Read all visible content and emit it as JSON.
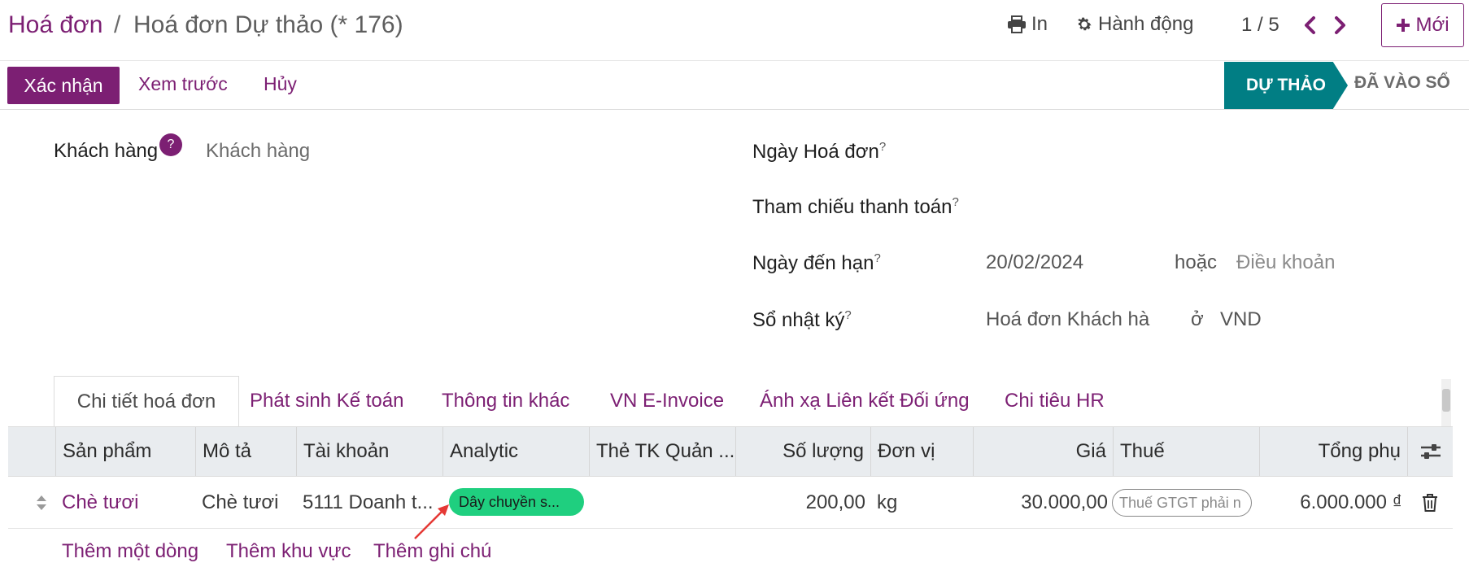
{
  "breadcrumb": {
    "root": "Hoá đơn",
    "separator": "/",
    "current": "Hoá đơn Dự thảo (* 176)"
  },
  "toolbar": {
    "print_label": "In",
    "action_label": "Hành động",
    "pager": "1 / 5",
    "new_label": "Mới"
  },
  "actions": {
    "confirm": "Xác nhận",
    "preview": "Xem trước",
    "cancel": "Hủy"
  },
  "status": {
    "draft": "DỰ THẢO",
    "posted": "ĐÃ VÀO SỔ"
  },
  "form": {
    "customer_label": "Khách hàng",
    "customer_help": "?",
    "customer_placeholder": "Khách hàng",
    "invoice_date_label": "Ngày Hoá đơn",
    "payment_ref_label": "Tham chiếu thanh toán",
    "due_date_label": "Ngày đến hạn",
    "due_date_value": "20/02/2024",
    "or_text": "hoặc",
    "terms_placeholder": "Điều khoản",
    "journal_label": "Sổ nhật ký",
    "journal_value": "Hoá đơn Khách hà",
    "in_text": "ở",
    "currency": "VND",
    "help_mark": "?"
  },
  "tabs": [
    "Chi tiết hoá đơn",
    "Phát sinh Kế toán",
    "Thông tin khác",
    "VN E-Invoice",
    "Ánh xạ Liên kết Đối ứng",
    "Chi tiêu HR"
  ],
  "table": {
    "columns": [
      "Sản phẩm",
      "Mô tả",
      "Tài khoản",
      "Analytic",
      "Thẻ TK Quản ...",
      "Số lượng",
      "Đơn vị",
      "Giá",
      "Thuế",
      "Tổng phụ"
    ],
    "row": {
      "product": "Chè tươi",
      "description": "Chè tươi",
      "account": "5111 Doanh t...",
      "analytic": "Dây chuyền s...",
      "quantity": "200,00",
      "uom": "kg",
      "price": "30.000,00",
      "tax_placeholder": "Thuế GTGT phải n",
      "subtotal": "6.000.000 ₫"
    },
    "add_line": "Thêm một dòng",
    "add_section": "Thêm khu vực",
    "add_note": "Thêm ghi chú"
  },
  "colors": {
    "brand": "#7c1f73",
    "status_active": "#017e84",
    "tag": "#1fcf7f",
    "annotation_arrow": "#e53935"
  }
}
